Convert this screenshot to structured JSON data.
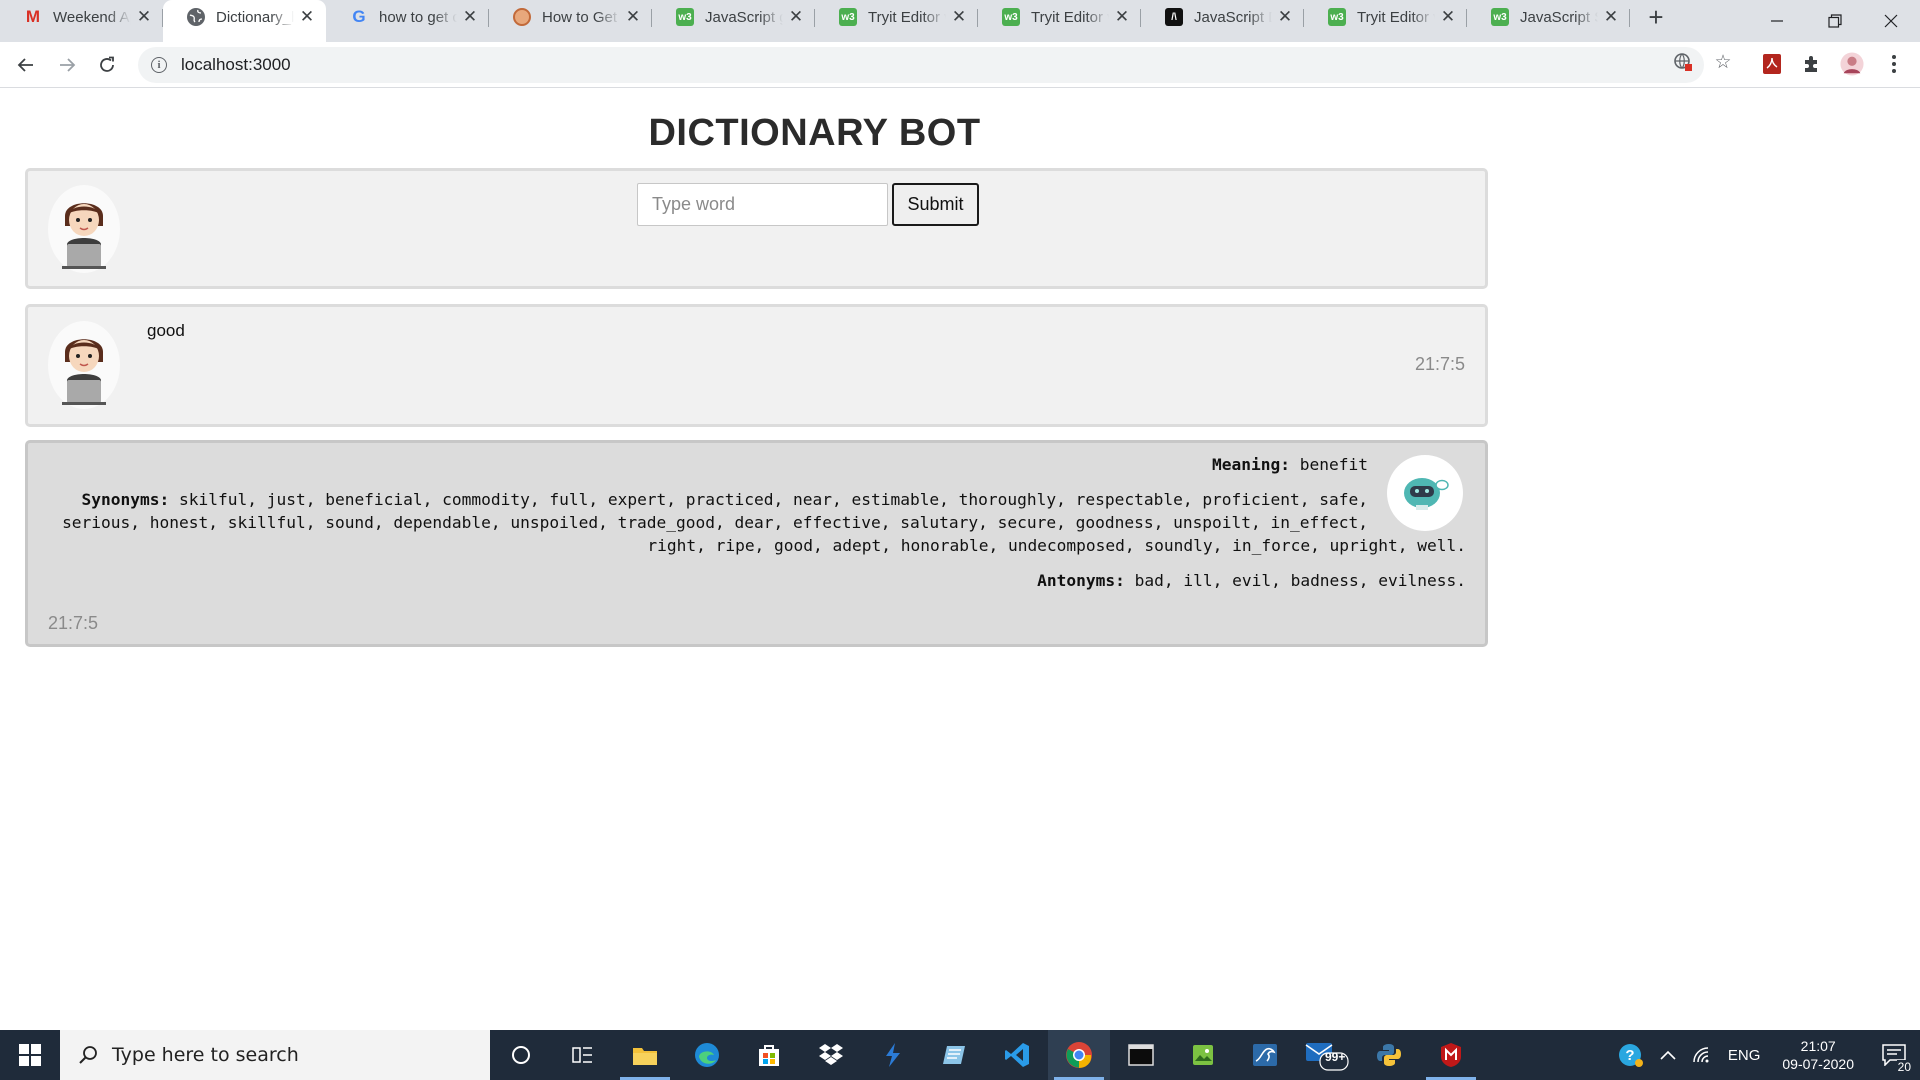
{
  "browser": {
    "tabs": [
      {
        "title": "Weekend Ap",
        "icon": "gmail-icon",
        "active": false
      },
      {
        "title": "Dictionary_b",
        "icon": "globe-icon",
        "active": true
      },
      {
        "title": "how to get c",
        "icon": "google-icon",
        "active": false
      },
      {
        "title": "How to Get (",
        "icon": "howto-icon",
        "active": false
      },
      {
        "title": "JavaScript g",
        "icon": "w3schools-icon",
        "active": false
      },
      {
        "title": "Tryit Editor v",
        "icon": "w3schools-icon",
        "active": false
      },
      {
        "title": "Tryit Editor v",
        "icon": "w3schools-icon",
        "active": false
      },
      {
        "title": "JavaScript D",
        "icon": "devdocs-icon",
        "active": false
      },
      {
        "title": "Tryit Editor v",
        "icon": "w3schools-icon",
        "active": false
      },
      {
        "title": "JavaScript St",
        "icon": "w3schools-icon",
        "active": false
      }
    ],
    "url": "localhost:3000"
  },
  "page": {
    "title": "DICTIONARY BOT",
    "input": {
      "placeholder": "Type word",
      "value": ""
    },
    "submit_label": "Submit",
    "user_message": {
      "text": "good",
      "time": "21:7:5"
    },
    "bot_message": {
      "meaning_label": "Meaning:",
      "meaning": "benefit",
      "synonyms_label": "Synonyms:",
      "synonyms_lines": [
        "skilful, just, beneficial, commodity, full, expert, practiced, near, estimable, thoroughly, respectable, proficient, safe,",
        "serious, honest, skillful, sound, dependable, unspoiled, trade_good, dear, effective, salutary, secure, goodness, unspoilt, in_effect,",
        "right, ripe, good, adept, honorable, undecomposed, soundly, in_force, upright, well."
      ],
      "antonyms_label": "Antonyms:",
      "antonyms": "bad, ill, evil, badness, evilness.",
      "time": "21:7:5"
    }
  },
  "taskbar": {
    "search_placeholder": "Type here to search",
    "mail_badge": "99+",
    "language": "ENG",
    "time": "21:07",
    "date": "09-07-2020",
    "notification_count": "20"
  }
}
